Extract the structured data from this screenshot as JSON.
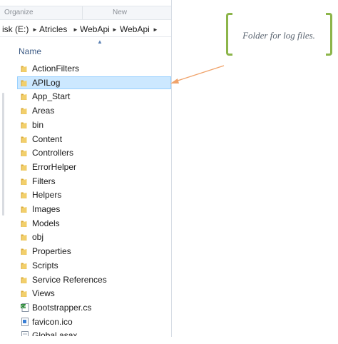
{
  "ribbon": {
    "organize_label": "Organize",
    "new_label": "New"
  },
  "address": {
    "segments": [
      "isk (E:)",
      "Atricles",
      "WebApi",
      "WebApi"
    ]
  },
  "columns": {
    "name_label": "Name"
  },
  "files": [
    {
      "label": "ActionFilters",
      "type": "folder"
    },
    {
      "label": "APILog",
      "type": "folder",
      "selected": true
    },
    {
      "label": "App_Start",
      "type": "folder"
    },
    {
      "label": "Areas",
      "type": "folder"
    },
    {
      "label": "bin",
      "type": "folder"
    },
    {
      "label": "Content",
      "type": "folder"
    },
    {
      "label": "Controllers",
      "type": "folder"
    },
    {
      "label": "ErrorHelper",
      "type": "folder"
    },
    {
      "label": "Filters",
      "type": "folder"
    },
    {
      "label": "Helpers",
      "type": "folder"
    },
    {
      "label": "Images",
      "type": "folder"
    },
    {
      "label": "Models",
      "type": "folder"
    },
    {
      "label": "obj",
      "type": "folder"
    },
    {
      "label": "Properties",
      "type": "folder"
    },
    {
      "label": "Scripts",
      "type": "folder"
    },
    {
      "label": "Service References",
      "type": "folder"
    },
    {
      "label": "Views",
      "type": "folder"
    },
    {
      "label": "Bootstrapper.cs",
      "type": "cs-file"
    },
    {
      "label": "favicon.ico",
      "type": "ico-file"
    },
    {
      "label": "Global.asax",
      "type": "file"
    }
  ],
  "callout": {
    "text": "Folder for log files."
  },
  "colors": {
    "selection": "#cce8ff",
    "folder": "#e8c25a",
    "callout_bracket": "#8cb54a",
    "arrow": "#f0a36b"
  }
}
